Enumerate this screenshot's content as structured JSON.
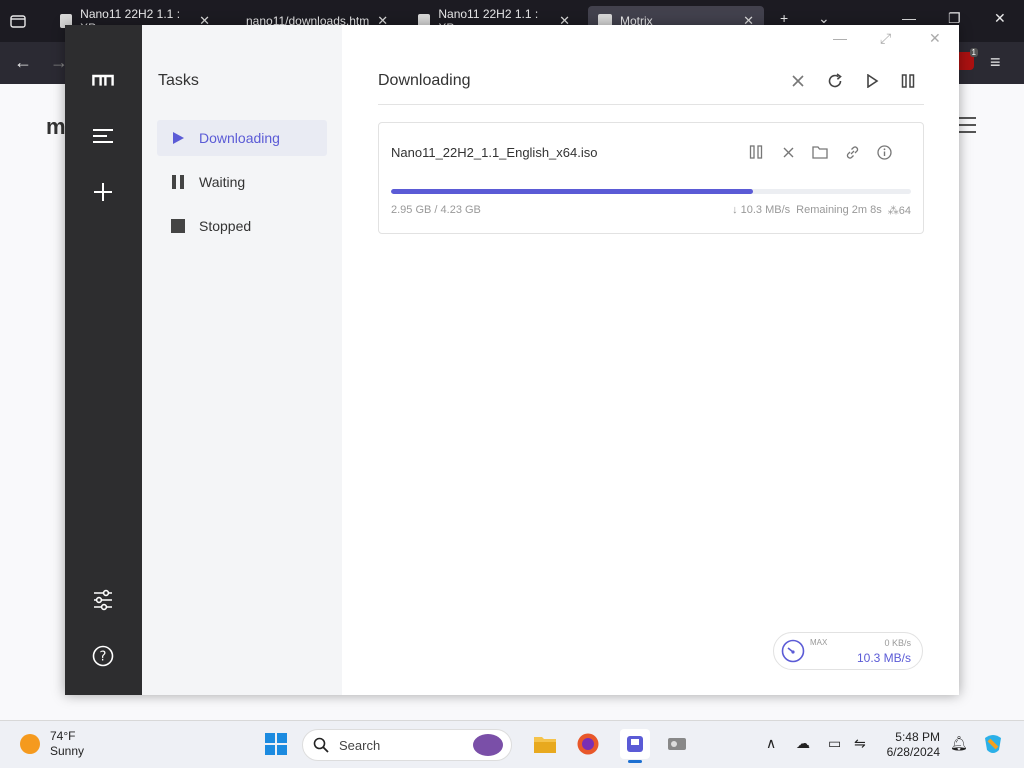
{
  "browser": {
    "tabs": [
      {
        "label": "Nano11 22H2 1.1 : XP..."
      },
      {
        "label": "nano11/downloads.htm"
      },
      {
        "label": "Nano11 22H2 1.1 : XP..."
      },
      {
        "label": "Motrix"
      }
    ],
    "notification_count": "1"
  },
  "app": {
    "sidebar": {
      "title": "Tasks",
      "items": [
        {
          "label": "Downloading"
        },
        {
          "label": "Waiting"
        },
        {
          "label": "Stopped"
        }
      ]
    },
    "main": {
      "title": "Downloading"
    },
    "task": {
      "filename": "Nano11_22H2_1.1_English_x64.iso",
      "progress_fraction": 0.697,
      "sizes": "2.95 GB / 4.23 GB",
      "speed": "↓ 10.3 MB/s",
      "remaining": "Remaining 2m 8s",
      "connections": "64"
    },
    "speedometer": {
      "max_label": "MAX",
      "upload": "0 KB/s",
      "download": "10.3 MB/s"
    },
    "accent_color": "#5b5bd6"
  },
  "taskbar": {
    "weather_temp": "74°F",
    "weather_desc": "Sunny",
    "search_placeholder": "Search",
    "time": "5:48 PM",
    "date": "6/28/2024"
  }
}
